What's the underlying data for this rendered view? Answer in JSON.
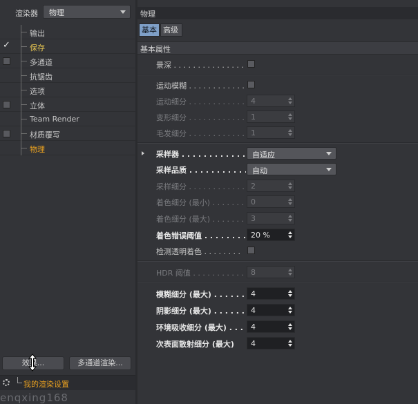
{
  "left": {
    "renderer_label": "渲染器",
    "renderer_value": "物理",
    "tree": [
      {
        "label": "输出",
        "check": "none",
        "style": "normal"
      },
      {
        "label": "保存",
        "check": "checked",
        "style": "yellow"
      },
      {
        "label": "多通道",
        "check": "box",
        "style": "normal"
      },
      {
        "label": "抗锯齿",
        "check": "none",
        "style": "normal"
      },
      {
        "label": "选项",
        "check": "none",
        "style": "normal"
      },
      {
        "label": "立体",
        "check": "box",
        "style": "normal"
      },
      {
        "label": "Team Render",
        "check": "none",
        "style": "normal"
      },
      {
        "label": "材质覆写",
        "check": "box",
        "style": "normal"
      },
      {
        "label": "物理",
        "check": "none",
        "style": "orange"
      }
    ],
    "checked_mark": "✓",
    "effect_button": "效果...",
    "multipass_button": "多通道渲染...",
    "settings_name": "我的渲染设置",
    "watermark": "enqxing168"
  },
  "right": {
    "title": "物理",
    "tabs": {
      "basic": "基本",
      "advanced": "高级"
    },
    "section": "基本属性",
    "depth_of_field": "景深 . . . . . . . . . . . . . . .",
    "motion_blur": "运动模糊 . . . . . . . . . . . .",
    "motion_subdiv": "运动细分 . . . . . . . . . . . .",
    "motion_subdiv_val": "4",
    "deform_subdiv": "变形细分 . . . . . . . . . . . .",
    "deform_subdiv_val": "1",
    "hair_subdiv": "毛发细分 . . . . . . . . . . . .",
    "hair_subdiv_val": "1",
    "sampler": "采样器 . . . . . . . . . . . . .",
    "sampler_val": "自适应",
    "sampling_quality": "采样品质 . . . . . . . . . . . .",
    "sampling_quality_val": "自动",
    "sampling_subdiv": "采样细分 . . . . . . . . . . . .",
    "sampling_subdiv_val": "2",
    "shading_subdiv_min": "着色细分 (最小) . . . . . . . .",
    "shading_subdiv_min_val": "0",
    "shading_subdiv_max": "着色细分 (最大) . . . . . . . .",
    "shading_subdiv_max_val": "3",
    "shading_error": "着色错误阈值 . . . . . . . .",
    "shading_error_val": "20 %",
    "detect_transparent": "检测透明着色 . . . . . . . .",
    "hdr_threshold": "HDR 阈值 . . . . . . . . . . . .",
    "hdr_threshold_val": "8",
    "blur_subdiv": "模糊细分 (最大) . . . . . . . .",
    "blur_subdiv_val": "4",
    "shadow_subdiv": "阴影细分 (最大) . . . . . . . .",
    "shadow_subdiv_val": "4",
    "ao_subdiv": "环境吸收细分 (最大) . . . .",
    "ao_subdiv_val": "4",
    "sss_subdiv": "次表面散射细分 (最大)",
    "sss_subdiv_val": "4"
  }
}
